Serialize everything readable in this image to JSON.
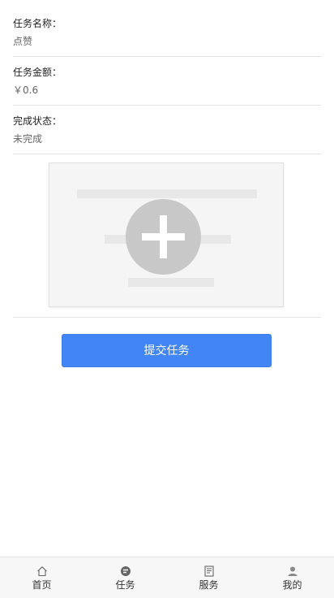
{
  "fields": [
    {
      "label": "任务名称：",
      "value": "点赞"
    },
    {
      "label": "任务金额：",
      "value": "￥0.6"
    },
    {
      "label": "完成状态：",
      "value": "未完成"
    }
  ],
  "upload": {
    "icon": "add-image-icon"
  },
  "submit": {
    "label": "提交任务"
  },
  "tabbar": {
    "items": [
      {
        "label": "首页",
        "icon": "home-icon"
      },
      {
        "label": "任务",
        "icon": "task-icon"
      },
      {
        "label": "服务",
        "icon": "service-icon"
      },
      {
        "label": "我的",
        "icon": "user-icon"
      }
    ]
  },
  "colors": {
    "accent": "#4286f5",
    "divider": "#e6e6e6",
    "tabbar_bg": "#f7f7f7"
  }
}
